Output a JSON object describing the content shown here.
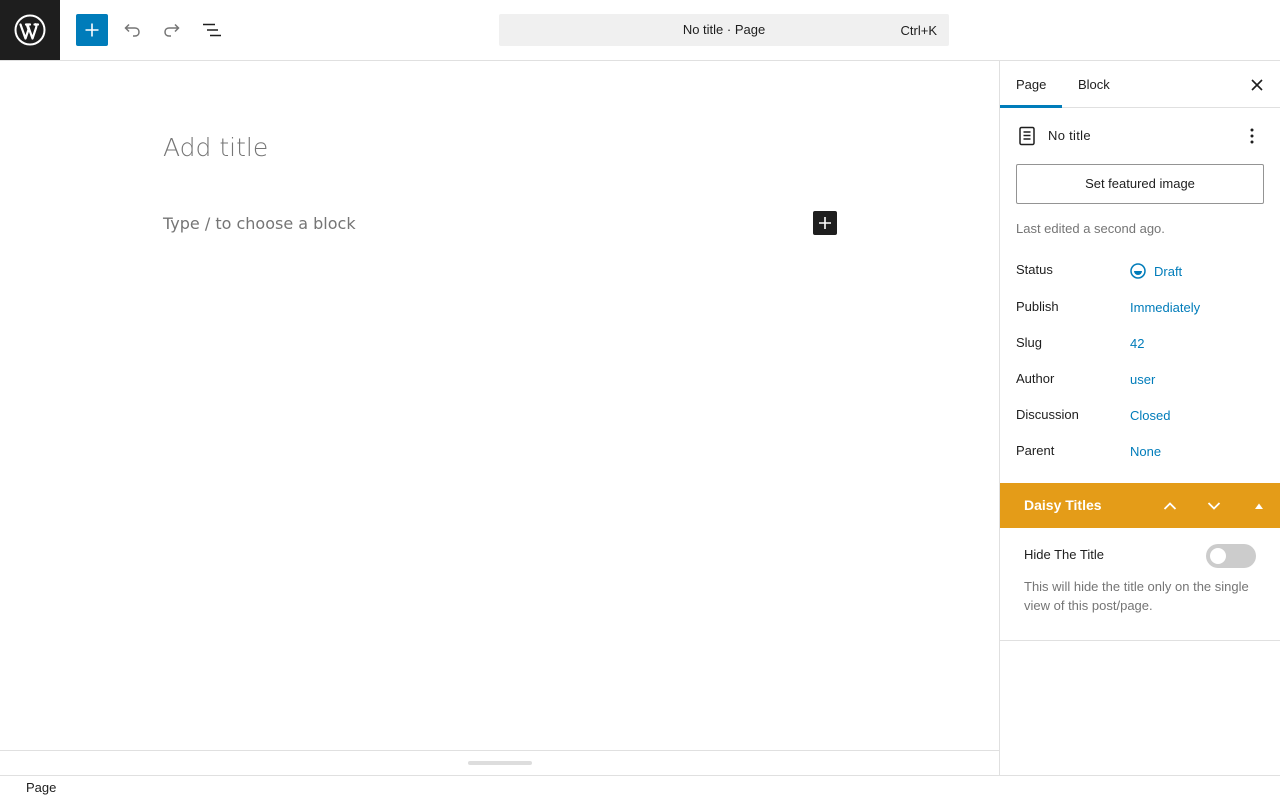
{
  "toolbar": {
    "logo_icon": "wordpress-icon",
    "inserter_icon": "plus-icon",
    "undo_icon": "undo-icon",
    "redo_icon": "redo-icon",
    "listview_icon": "list-view-icon",
    "command_title": "No title · Page",
    "command_shortcut": "Ctrl+K",
    "accent_color": "#007cba"
  },
  "editor": {
    "title_placeholder": "Add title",
    "block_placeholder": "Type / to choose a block"
  },
  "footer": {
    "breadcrumb": "Page"
  },
  "sidebar": {
    "tabs": [
      {
        "label": "Page",
        "active": true
      },
      {
        "label": "Block",
        "active": false
      }
    ],
    "doc_title": "No title",
    "featured_image_button": "Set featured image",
    "last_edited": "Last edited a second ago.",
    "meta": [
      {
        "label": "Status",
        "value": "Draft"
      },
      {
        "label": "Publish",
        "value": "Immediately"
      },
      {
        "label": "Slug",
        "value": "42"
      },
      {
        "label": "Author",
        "value": "user"
      },
      {
        "label": "Discussion",
        "value": "Closed"
      },
      {
        "label": "Parent",
        "value": "None"
      }
    ]
  },
  "daisy_panel": {
    "title": "Daisy Titles",
    "header_color": "#e49c18",
    "toggle_label": "Hide The Title",
    "toggle_on": false,
    "help_text": "This will hide the title only on the single view of this post/page."
  }
}
